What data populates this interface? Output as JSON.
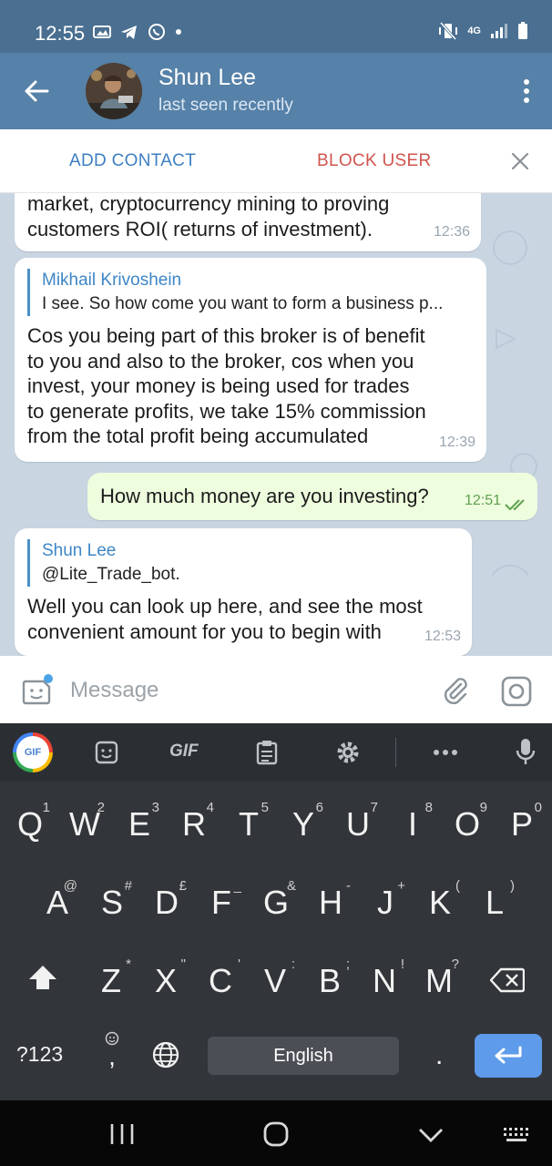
{
  "status_bar": {
    "time": "12:55",
    "network": "4G"
  },
  "contact": {
    "name": "Shun Lee",
    "status": "last seen recently"
  },
  "actions": {
    "add_contact": "ADD CONTACT",
    "block_user": "BLOCK USER"
  },
  "messages": [
    {
      "text_lines": [
        "market, cryptocurrency mining to proving",
        "customers ROI( returns of investment)."
      ],
      "time": "12:36"
    },
    {
      "reply_name": "Mikhail Krivoshein",
      "reply_text": "I see. So how come you want to form a business p...",
      "text_lines": [
        "Cos you being part of this broker is of benefit",
        "to you and also to the broker, cos when you",
        "invest, your money is being used for trades",
        "to generate profits, we take 15% commission",
        "from the total profit being accumulated"
      ],
      "time": "12:39"
    },
    {
      "text": "How much money are you investing?",
      "time": "12:51"
    },
    {
      "reply_name": "Shun Lee",
      "reply_text": "@Lite_Trade_bot.",
      "text_lines": [
        "Well you can look up here, and see the most",
        "convenient amount for you to begin with"
      ],
      "time": "12:53"
    }
  ],
  "input": {
    "placeholder": "Message"
  },
  "keyboard": {
    "toolbar_gif": "GIF",
    "row1": [
      {
        "k": "Q",
        "s": "1"
      },
      {
        "k": "W",
        "s": "2"
      },
      {
        "k": "E",
        "s": "3"
      },
      {
        "k": "R",
        "s": "4"
      },
      {
        "k": "T",
        "s": "5"
      },
      {
        "k": "Y",
        "s": "6"
      },
      {
        "k": "U",
        "s": "7"
      },
      {
        "k": "I",
        "s": "8"
      },
      {
        "k": "O",
        "s": "9"
      },
      {
        "k": "P",
        "s": "0"
      }
    ],
    "row2": [
      {
        "k": "A",
        "s": "@"
      },
      {
        "k": "S",
        "s": "#"
      },
      {
        "k": "D",
        "s": "£"
      },
      {
        "k": "F",
        "s": "_"
      },
      {
        "k": "G",
        "s": "&"
      },
      {
        "k": "H",
        "s": "-"
      },
      {
        "k": "J",
        "s": "+"
      },
      {
        "k": "K",
        "s": "("
      },
      {
        "k": "L",
        "s": ")"
      }
    ],
    "row3": [
      {
        "k": "Z",
        "s": "*"
      },
      {
        "k": "X",
        "s": "\""
      },
      {
        "k": "C",
        "s": "'"
      },
      {
        "k": "V",
        "s": ":"
      },
      {
        "k": "B",
        "s": ";"
      },
      {
        "k": "N",
        "s": "!"
      },
      {
        "k": "M",
        "s": "?"
      }
    ],
    "symbols": "?123",
    "comma": ",",
    "space": "English",
    "period": "."
  },
  "colors": {
    "header": "#5681a8",
    "status_bar": "#4a6f91",
    "accent": "#3d7fc2",
    "danger": "#d0544e",
    "outgoing": "#eefdde",
    "chat_bg": "#c9d6e2"
  }
}
